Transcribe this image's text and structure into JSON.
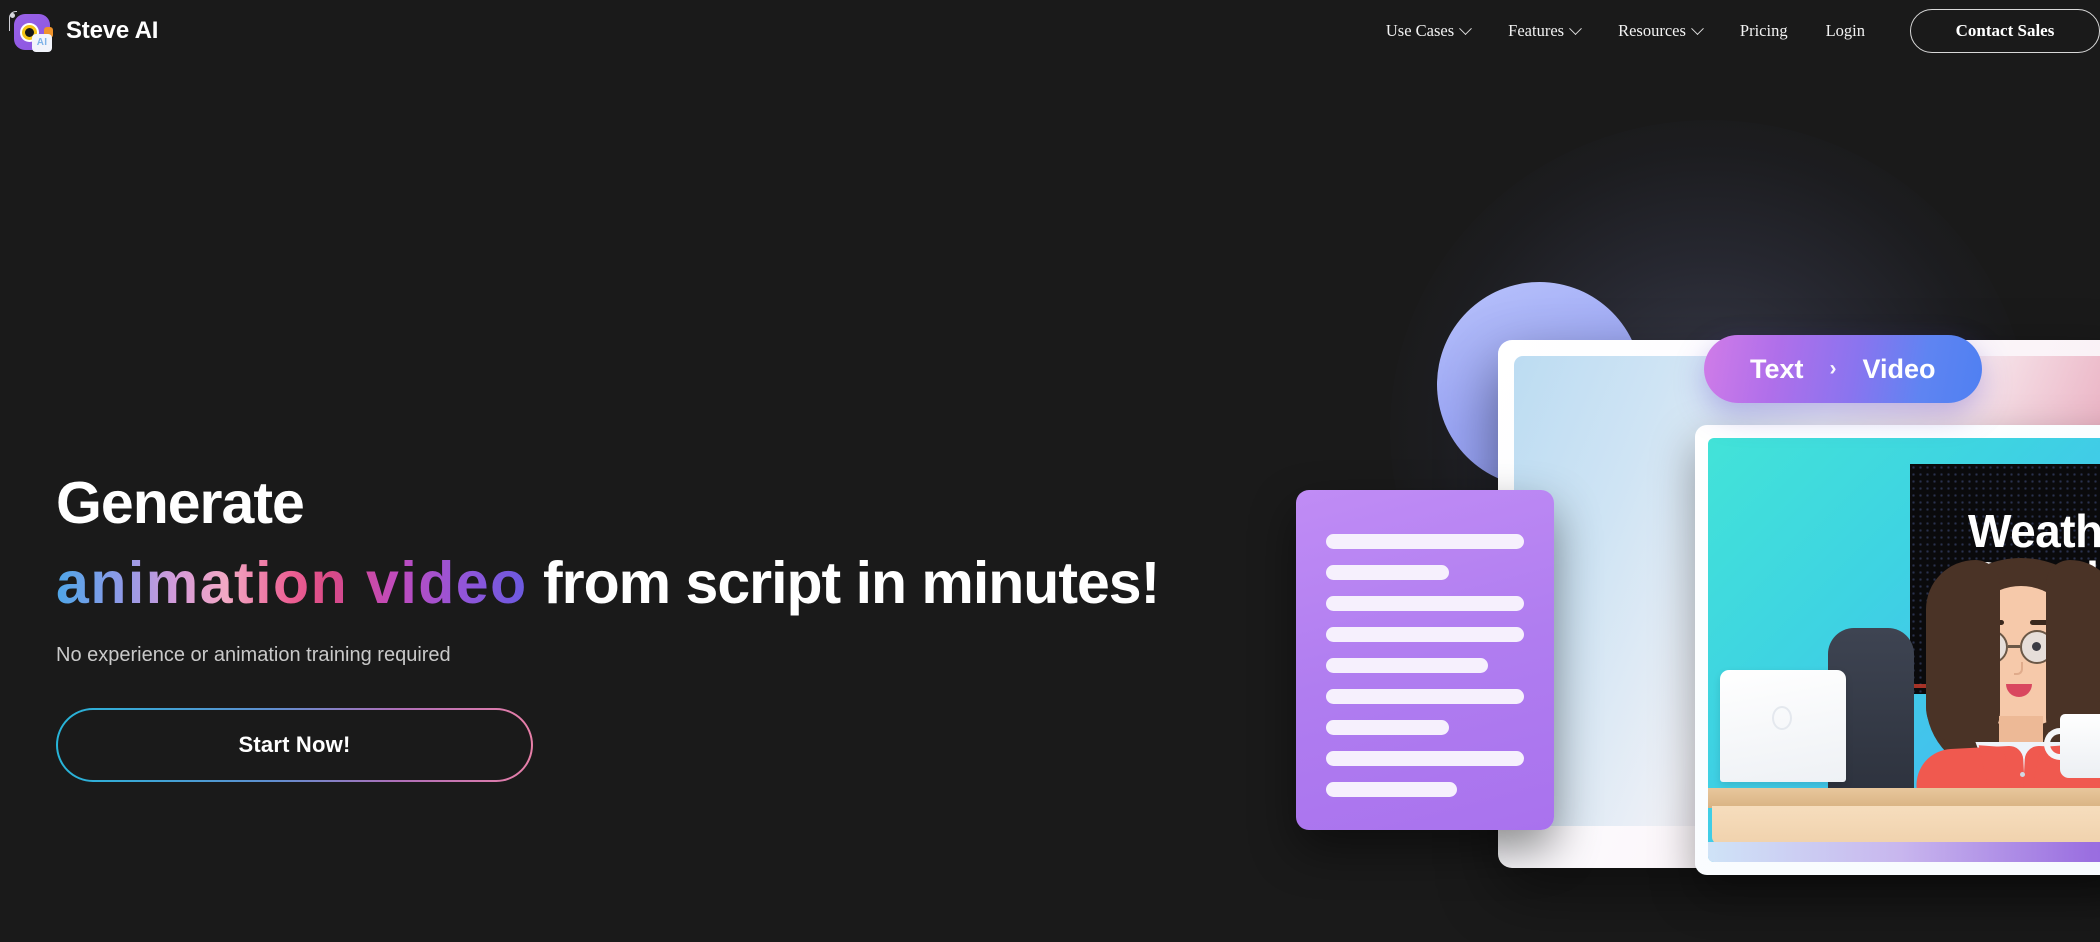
{
  "brand": {
    "name": "Steve AI",
    "logo_icon": "camera-ai-logo-icon",
    "badge_text": "AI"
  },
  "nav": {
    "items": [
      {
        "label": "Use Cases",
        "has_dropdown": true
      },
      {
        "label": "Features",
        "has_dropdown": true
      },
      {
        "label": "Resources",
        "has_dropdown": true
      },
      {
        "label": "Pricing",
        "has_dropdown": false
      },
      {
        "label": "Login",
        "has_dropdown": false
      }
    ],
    "cta_label": "Contact Sales"
  },
  "hero": {
    "headline_line1": "Generate",
    "headline_gradient": "animation video",
    "headline_rest": " from script in minutes!",
    "subhead": "No experience or animation training required",
    "cta_label": "Start Now!"
  },
  "illustration": {
    "badge_left": "Text",
    "badge_arrow": "›",
    "badge_right": "Video",
    "tv_line1": "Weather",
    "tv_line2": "Broadcast",
    "doc_lines": [
      100,
      62,
      100,
      100,
      82,
      100,
      62,
      100,
      66
    ]
  },
  "colors": {
    "background": "#1a1a1a",
    "accent_cyan": "#26b5d9",
    "accent_pink": "#e87fa8",
    "accent_purple": "#9a62e8",
    "accent_blue": "#4f80f2",
    "text_primary": "#ffffff",
    "text_muted": "#c9c9c9"
  }
}
